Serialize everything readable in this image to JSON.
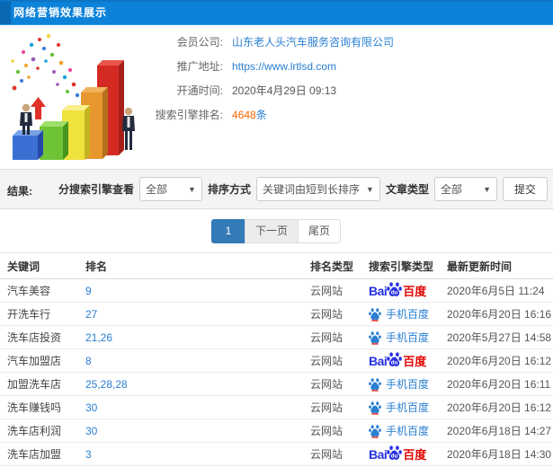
{
  "header": {
    "title": "网络营销效果展示"
  },
  "member": {
    "company_label": "会员公司:",
    "company_value": "山东老人头汽车服务咨询有限公司",
    "url_label": "推广地址:",
    "url_value": "https://www.lrtlsd.com",
    "open_time_label": "开通时间:",
    "open_time_value": "2020年4月29日 09:13",
    "rank_label": "搜索引擎排名:",
    "rank_count": "4648",
    "rank_unit": "条"
  },
  "filters": {
    "result_label": "结果:",
    "engine_view_label": "分搜索引擎查看",
    "engine_view_value": "全部",
    "sort_label": "排序方式",
    "sort_value": "关键词由短到长排序",
    "article_type_label": "文章类型",
    "article_type_value": "全部",
    "submit_label": "提交"
  },
  "pagination": {
    "current": "1",
    "next": "下一页",
    "last": "尾页"
  },
  "table": {
    "headers": [
      "关键词",
      "排名",
      "排名类型",
      "搜索引擎类型",
      "最新更新时间"
    ],
    "logo": {
      "bai": "Bai",
      "du": "du",
      "baidu_text": "百度",
      "mobile_text": "手机百度"
    },
    "rows": [
      {
        "keyword": "汽车美容",
        "rank": "9",
        "rank_type": "云网站",
        "engine": "baidu",
        "updated": "2020年6月5日 11:24"
      },
      {
        "keyword": "开洗车行",
        "rank": "27",
        "rank_type": "云网站",
        "engine": "mobile",
        "updated": "2020年6月20日 16:16"
      },
      {
        "keyword": "洗车店投资",
        "rank": "21,26",
        "rank_type": "云网站",
        "engine": "mobile",
        "updated": "2020年5月27日 14:58"
      },
      {
        "keyword": "汽车加盟店",
        "rank": "8",
        "rank_type": "云网站",
        "engine": "baidu",
        "updated": "2020年6月20日 16:12"
      },
      {
        "keyword": "加盟洗车店",
        "rank": "25,28,28",
        "rank_type": "云网站",
        "engine": "mobile",
        "updated": "2020年6月20日 16:11"
      },
      {
        "keyword": "洗车赚钱吗",
        "rank": "30",
        "rank_type": "云网站",
        "engine": "mobile",
        "updated": "2020年6月20日 16:12"
      },
      {
        "keyword": "洗车店利润",
        "rank": "30",
        "rank_type": "云网站",
        "engine": "mobile",
        "updated": "2020年6月18日 14:27"
      },
      {
        "keyword": "洗车店加盟",
        "rank": "3",
        "rank_type": "云网站",
        "engine": "baidu",
        "updated": "2020年6月18日 14:30"
      }
    ]
  },
  "colors": {
    "topbar_blue": "#0c82d8",
    "link_blue": "#2a7fd1",
    "rank_orange": "#ff6600",
    "baidu_blue": "#2932e1",
    "baidu_red": "#e10602",
    "active_page_blue": "#337ab7"
  }
}
